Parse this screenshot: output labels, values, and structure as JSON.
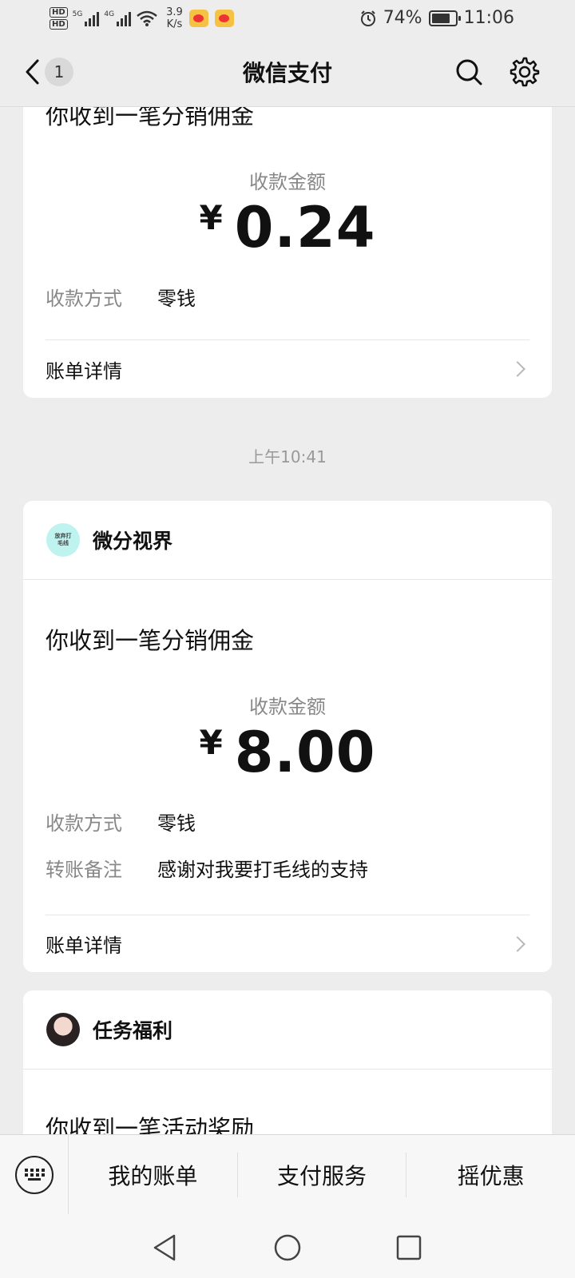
{
  "status_bar": {
    "network_label_1": "HD",
    "network_label_2": "HD",
    "sig1": "5G",
    "sig2": "4G",
    "speed_value": "3.9",
    "speed_unit": "K/s",
    "battery": "74%",
    "time": "11:06"
  },
  "nav": {
    "unread_count": "1",
    "title": "微信支付"
  },
  "messages": [
    {
      "title": "你收到一笔分销佣金",
      "amount_label": "收款金额",
      "currency": "¥",
      "amount": "0.24",
      "rows": [
        {
          "key": "收款方式",
          "value": "零钱"
        }
      ],
      "detail_label": "账单详情"
    },
    {
      "time": "上午10:41",
      "merchant": "微分视界",
      "avatar_text": "放弃打\n毛线",
      "title": "你收到一笔分销佣金",
      "amount_label": "收款金额",
      "currency": "¥",
      "amount": "8.00",
      "rows": [
        {
          "key": "收款方式",
          "value": "零钱"
        },
        {
          "key": "转账备注",
          "value": "感谢对我要打毛线的支持"
        }
      ],
      "detail_label": "账单详情"
    },
    {
      "merchant": "任务福利",
      "title": "你收到一笔活动奖励"
    }
  ],
  "bottom_menu": {
    "items": [
      "我的账单",
      "支付服务",
      "摇优惠"
    ]
  },
  "colors": {
    "background": "#ededed",
    "card": "#ffffff",
    "muted_text": "#888888",
    "avatar_mint": "#bff3f0"
  }
}
